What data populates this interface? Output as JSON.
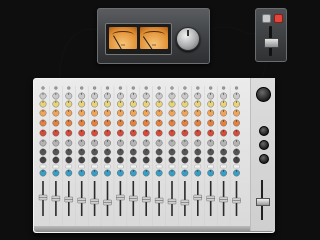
{
  "vu_meter": {
    "title": "",
    "left_meter_label": "VU",
    "right_meter_label": "VU",
    "knob_icon": "silver-knob-icon",
    "face_color": "#e69a3d"
  },
  "fader_remote": {
    "button_gray_icon": "gray-button-icon",
    "button_red_icon": "red-button-icon",
    "red_color": "#e2463a"
  },
  "mixer": {
    "channel_count": 16,
    "knob_row_colors": [
      "#c9c9c9",
      "#e8d27a",
      "#f0a45a",
      "#e6803f",
      "#d64b3b",
      "#b3b3b3",
      "#555555",
      "#444444",
      "#3a9ec4"
    ],
    "channel_names": [
      "",
      "",
      "",
      "",
      "",
      "",
      "",
      "",
      "",
      "",
      "",
      "",
      "",
      "",
      "",
      ""
    ],
    "master": {
      "label": "",
      "knob_icon": "master-knob-icon"
    }
  }
}
